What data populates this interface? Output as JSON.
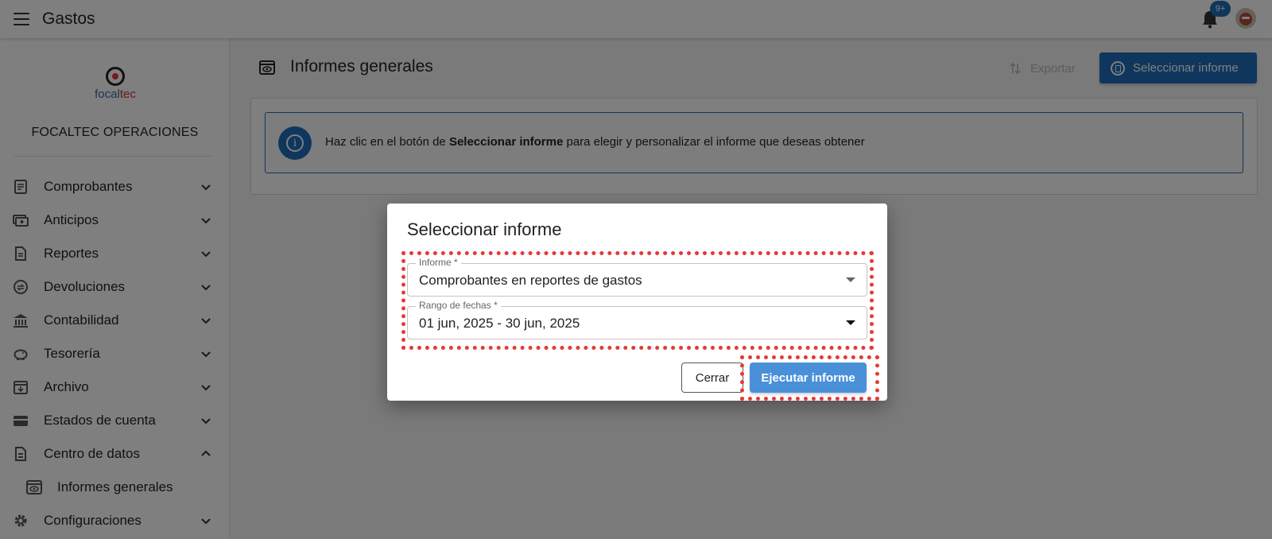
{
  "appbar": {
    "title": "Gastos",
    "badge": "9+"
  },
  "sidebar": {
    "logo_text_a": "focal",
    "logo_text_b": "tec",
    "company": "FOCALTEC OPERACIONES",
    "items": [
      {
        "label": "Comprobantes",
        "icon": "receipt-icon"
      },
      {
        "label": "Anticipos",
        "icon": "cash-icon"
      },
      {
        "label": "Reportes",
        "icon": "report-icon"
      },
      {
        "label": "Devoluciones",
        "icon": "refund-icon"
      },
      {
        "label": "Contabilidad",
        "icon": "bank-icon"
      },
      {
        "label": "Tesorería",
        "icon": "piggy-bank-icon"
      },
      {
        "label": "Archivo",
        "icon": "archive-icon"
      },
      {
        "label": "Estados de cuenta",
        "icon": "wallet-icon"
      },
      {
        "label": "Centro de datos",
        "icon": "data-center-icon"
      },
      {
        "label": "Informes generales",
        "icon": "eye-report-icon"
      },
      {
        "label": "Configuraciones",
        "icon": "gear-icon"
      }
    ]
  },
  "main": {
    "title": "Informes generales",
    "export_label": "Exportar",
    "select_label": "Seleccionar informe",
    "info": {
      "prefix": "Haz clic en el botón de ",
      "bold": "Seleccionar informe",
      "suffix": " para elegir y personalizar el informe que deseas obtener"
    }
  },
  "dialog": {
    "title": "Seleccionar informe",
    "informe_label": "Informe *",
    "informe_value": "Comprobantes en reportes de gastos",
    "rango_label": "Rango de fechas *",
    "rango_value": "01 jun, 2025 - 30 jun, 2025",
    "cerrar_label": "Cerrar",
    "ejecutar_label": "Ejecutar informe"
  },
  "colors": {
    "primary": "#1e6fba",
    "accent": "#4a90d9",
    "highlight": "#e53935"
  }
}
